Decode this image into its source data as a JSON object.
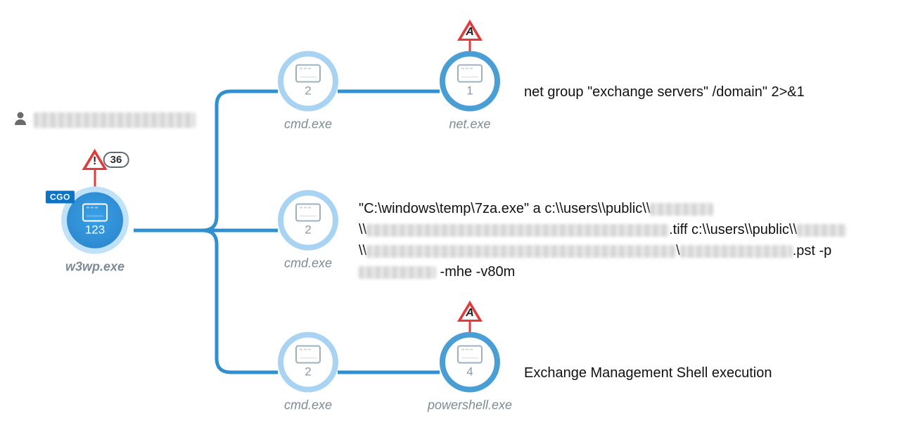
{
  "user_row": {
    "redacted_width": 230
  },
  "root": {
    "tag": "CGO",
    "count": "123",
    "label": "w3wp.exe",
    "alert": {
      "glyph": "!",
      "badge": "36"
    }
  },
  "children": [
    {
      "count": "2",
      "label": "cmd.exe",
      "grandchild": {
        "count": "1",
        "label": "net.exe",
        "alert_glyph": "A"
      },
      "annotation": "net group \"exchange servers\" /domain\" 2>&1"
    },
    {
      "count": "2",
      "label": "cmd.exe",
      "annotation_parts": {
        "p1": "\"C:\\windows\\temp\\7za.exe\" a c:\\\\users\\\\public\\\\",
        "p2": "\\\\",
        "p3": ".tiff c:\\\\users\\\\public\\\\",
        "p4": "\\\\",
        "p5": "\\",
        "p6": ".pst -p",
        "p7": " -mhe -v80m"
      }
    },
    {
      "count": "2",
      "label": "cmd.exe",
      "grandchild": {
        "count": "4",
        "label": "powershell.exe",
        "alert_glyph": "A"
      },
      "annotation": "Exchange Management Shell execution"
    }
  ]
}
